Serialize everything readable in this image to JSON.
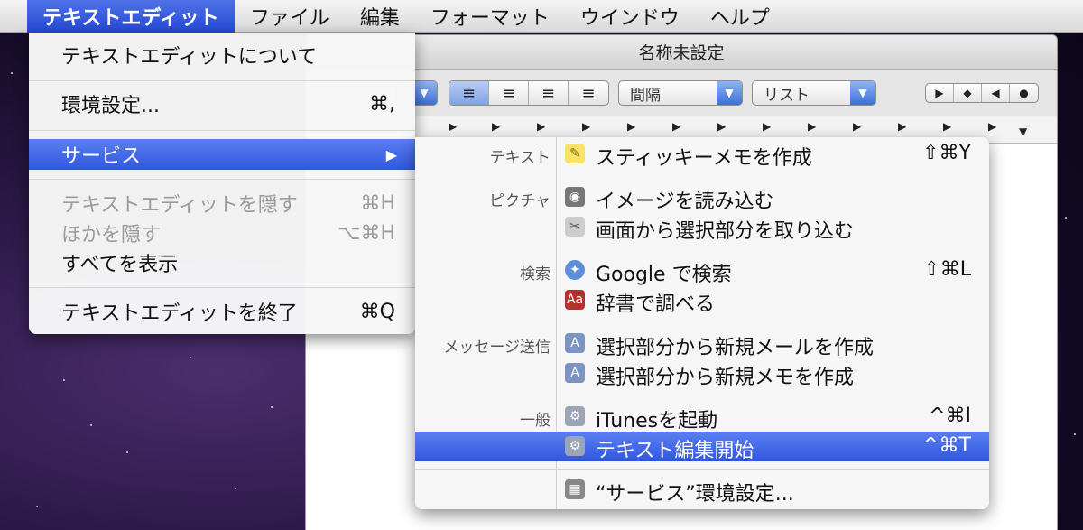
{
  "menubar": {
    "apple_icon": "apple-icon",
    "items": [
      "テキストエディット",
      "ファイル",
      "編集",
      "フォーマット",
      "ウインドウ",
      "ヘルプ"
    ]
  },
  "window": {
    "title": "名称未設定",
    "toolbar": {
      "spacing_label": "間隔",
      "list_label": "リスト"
    }
  },
  "app_menu": {
    "items": [
      {
        "label": "テキストエディットについて",
        "shortcut": ""
      },
      {
        "label": "環境設定...",
        "shortcut": "⌘,"
      },
      {
        "label": "サービス",
        "shortcut": "▶"
      },
      {
        "label": "テキストエディットを隠す",
        "shortcut": "⌘H"
      },
      {
        "label": "ほかを隠す",
        "shortcut": "⌥⌘H"
      },
      {
        "label": "すべてを表示",
        "shortcut": ""
      },
      {
        "label": "テキストエディットを終了",
        "shortcut": "⌘Q"
      }
    ]
  },
  "services": {
    "categories": [
      "テキスト",
      "ピクチャ",
      "検索",
      "メッセージ送信",
      "一般"
    ],
    "items": [
      {
        "label": "スティッキーメモを作成",
        "shortcut": "⇧⌘Y",
        "icon": "sticky-note-icon"
      },
      {
        "label": "イメージを読み込む",
        "shortcut": "",
        "icon": "camera-icon"
      },
      {
        "label": "画面から選択部分を取り込む",
        "shortcut": "",
        "icon": "grab-icon"
      },
      {
        "label": "Google で検索",
        "shortcut": "⇧⌘L",
        "icon": "safari-compass-icon"
      },
      {
        "label": "辞書で調べる",
        "shortcut": "",
        "icon": "dictionary-icon"
      },
      {
        "label": "選択部分から新規メールを作成",
        "shortcut": "",
        "icon": "automator-icon"
      },
      {
        "label": "選択部分から新規メモを作成",
        "shortcut": "",
        "icon": "automator-icon"
      },
      {
        "label": "iTunesを起動",
        "shortcut": "^⌘I",
        "icon": "automator-robot-icon"
      },
      {
        "label": "テキスト編集開始",
        "shortcut": "^⌘T",
        "icon": "automator-robot-icon"
      },
      {
        "label": "“サービス”環境設定...",
        "shortcut": "",
        "icon": "preferences-icon"
      }
    ]
  }
}
